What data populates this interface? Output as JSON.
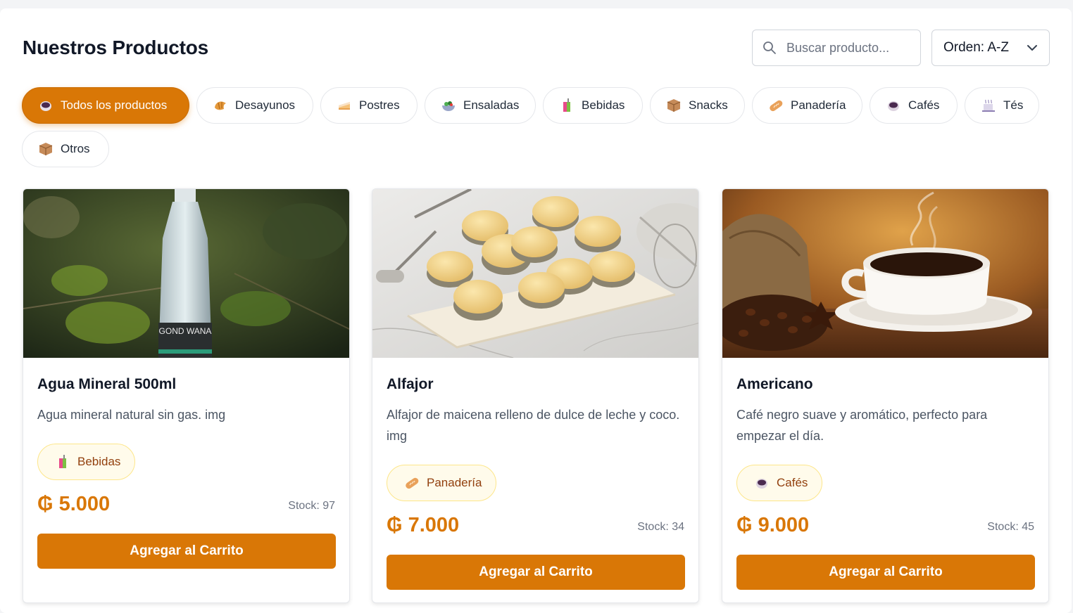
{
  "header": {
    "title": "Nuestros Productos",
    "search_placeholder": "Buscar producto...",
    "order_label": "Orden: A-Z"
  },
  "categories": [
    {
      "label": "Todos los productos",
      "icon": "coffee-cup-icon",
      "active": true
    },
    {
      "label": "Desayunos",
      "icon": "croissant-icon"
    },
    {
      "label": "Postres",
      "icon": "cake-icon"
    },
    {
      "label": "Ensaladas",
      "icon": "salad-icon"
    },
    {
      "label": "Bebidas",
      "icon": "juice-box-icon"
    },
    {
      "label": "Snacks",
      "icon": "package-icon"
    },
    {
      "label": "Panadería",
      "icon": "bread-icon"
    },
    {
      "label": "Cafés",
      "icon": "coffee-cup-icon"
    },
    {
      "label": "Tés",
      "icon": "hot-drink-icon"
    },
    {
      "label": "Otros",
      "icon": "package-icon"
    }
  ],
  "products": [
    {
      "name": "Agua Mineral 500ml",
      "description": "Agua mineral natural sin gas. img",
      "category": "Bebidas",
      "category_icon": "juice-box-icon",
      "price": "₲ 5.000",
      "stock": "Stock: 97",
      "button": "Agregar al Carrito",
      "bottle_label": "GOND WANA"
    },
    {
      "name": "Alfajor",
      "description": "Alfajor de maicena relleno de dulce de leche y coco. img",
      "category": "Panadería",
      "category_icon": "bread-icon",
      "price": "₲ 7.000",
      "stock": "Stock: 34",
      "button": "Agregar al Carrito"
    },
    {
      "name": "Americano",
      "description": "Café negro suave y aromático, perfecto para empezar el día.",
      "category": "Cafés",
      "category_icon": "coffee-cup-icon",
      "price": "₲ 9.000",
      "stock": "Stock: 45",
      "button": "Agregar al Carrito"
    }
  ],
  "colors": {
    "accent": "#d97706",
    "badge_bg": "#fffbeb",
    "badge_border": "#fde68a",
    "badge_text": "#92400e"
  }
}
